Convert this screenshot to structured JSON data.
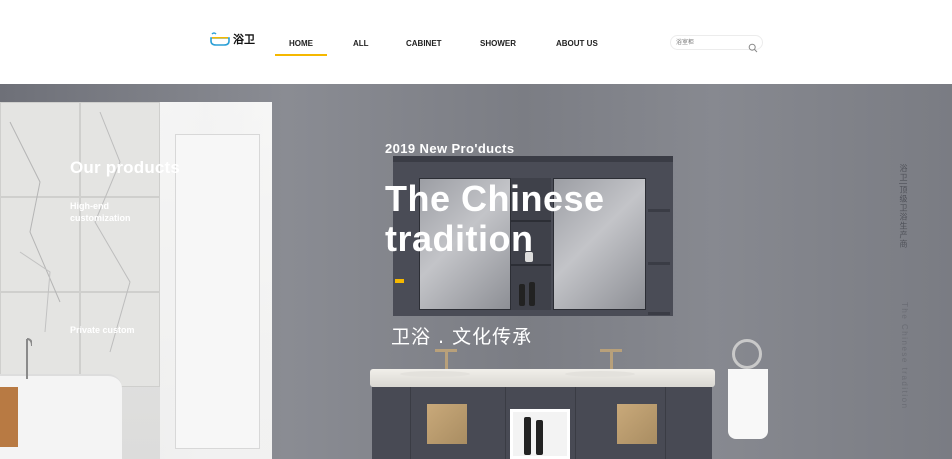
{
  "brand": {
    "name": "浴卫"
  },
  "nav": {
    "items": [
      {
        "label": "HOME"
      },
      {
        "label": "ALL"
      },
      {
        "label": "CABINET"
      },
      {
        "label": "SHOWER"
      },
      {
        "label": "ABOUT US"
      }
    ],
    "active": "HOME"
  },
  "search": {
    "placeholder": "浴室柜"
  },
  "sidebar": {
    "title": "Our products",
    "items": [
      {
        "label": "High-end customization"
      },
      {
        "label": "Private custom"
      }
    ]
  },
  "hero": {
    "eyebrow": "2019 New Pro'ducts",
    "headline": "The Chinese tradition",
    "slogan": "卫浴 . 文化传承",
    "vertical_cn": "浴卫|顶级卫浴生产商",
    "vertical_en": "The Chinese tradition"
  },
  "colors": {
    "accent": "#f5b800",
    "hero_bg": "#7d7f86",
    "header_bg": "#ffffff"
  },
  "icons": [
    "bathtub-logo-icon",
    "search-icon"
  ]
}
